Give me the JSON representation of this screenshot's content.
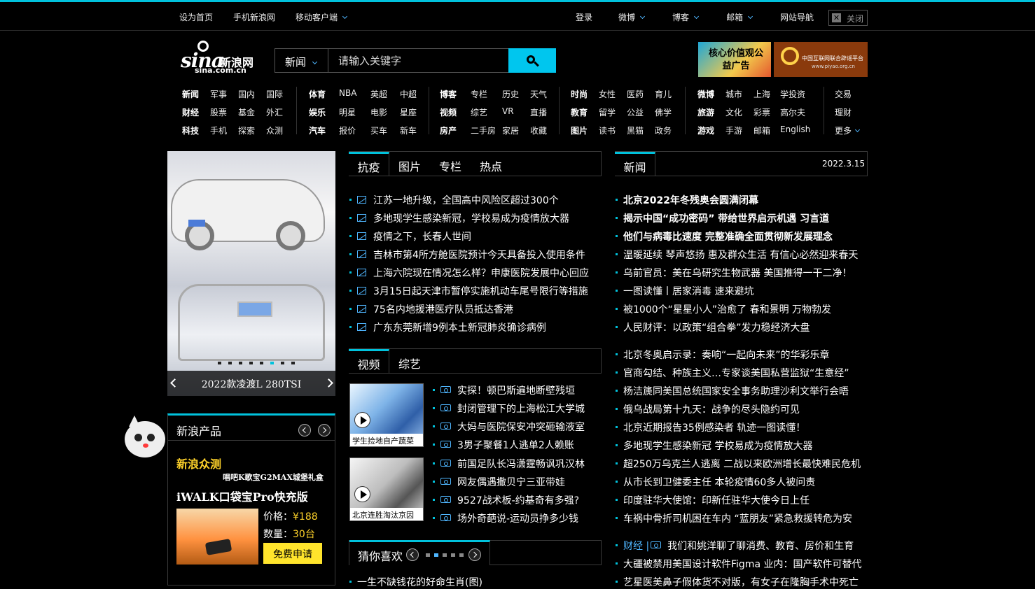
{
  "topbar": {
    "left": [
      "设为首页",
      "手机新浪网",
      "移动客户端"
    ],
    "right": [
      "登录",
      "微博",
      "博客",
      "邮箱",
      "网站导航"
    ],
    "close_label": "关闭"
  },
  "logo": {
    "text": "sina",
    "cn": "新浪网",
    "domain": "sina.com.cn"
  },
  "search": {
    "category": "新闻",
    "placeholder": "请输入关键字"
  },
  "ads": {
    "ad1": "核心价值观公益广告",
    "ad2_line1": "中国互联网联合辟谣平台",
    "ad2_line2": "www.piyao.org.cn"
  },
  "nav": {
    "col1": [
      [
        "新闻",
        "军事",
        "国内",
        "国际"
      ],
      [
        "财经",
        "股票",
        "基金",
        "外汇"
      ],
      [
        "科技",
        "手机",
        "探索",
        "众测"
      ]
    ],
    "col2": [
      [
        "体育",
        "NBA",
        "英超",
        "中超"
      ],
      [
        "娱乐",
        "明星",
        "电影",
        "星座"
      ],
      [
        "汽车",
        "报价",
        "买车",
        "新车"
      ]
    ],
    "col3": [
      [
        "博客",
        "专栏",
        "历史",
        "天气"
      ],
      [
        "视频",
        "综艺",
        "VR",
        "直播"
      ],
      [
        "房产",
        "二手房",
        "家居",
        "收藏"
      ]
    ],
    "col4": [
      [
        "时尚",
        "女性",
        "医药",
        "育儿"
      ],
      [
        "教育",
        "留学",
        "公益",
        "佛学"
      ],
      [
        "图片",
        "读书",
        "黑猫",
        "政务"
      ]
    ],
    "col5": [
      [
        "微博",
        "城市",
        "上海",
        "学投资"
      ],
      [
        "旅游",
        "文化",
        "彩票",
        "高尔夫"
      ],
      [
        "游戏",
        "手游",
        "邮箱",
        "English"
      ]
    ],
    "col6": [
      "交易",
      "理财",
      "更多"
    ]
  },
  "slide": {
    "caption": "2022款凌渡L 280TSI",
    "dot_count": 8,
    "active_dot": 5
  },
  "product": {
    "title": "新浪产品",
    "sub": "新浪众测",
    "tag": "唱吧K歌宝G2MAX城堡礼盒",
    "name": "iWALK口袋宝Pro快充版",
    "price_label": "价格：",
    "price": "¥188",
    "qty_label": "数量：",
    "qty": "30台",
    "apply": "免费申请"
  },
  "tabs1": {
    "items": [
      "抗疫",
      "图片",
      "专栏",
      "热点"
    ]
  },
  "list1": [
    "江苏一地升级，全国高中风险区超过300个",
    "多地现学生感染新冠，学校易成为疫情放大器",
    "疫情之下，长春人世间",
    "吉林市第4所方舱医院预计今天具备投入使用条件",
    "上海六院现在情况怎么样？申康医院发展中心回应",
    "3月15日起天津市暂停实施机动车尾号限行等措施",
    "75名内地援港医疗队员抵达香港",
    "广东东莞新增9例本土新冠肺炎确诊病例"
  ],
  "tabs2": {
    "items": [
      "视频",
      "综艺"
    ]
  },
  "videos": {
    "thumb1_caption": "学生捡地自产蔬菜",
    "thumb2_caption": "北京连胜淘汰京因",
    "items": [
      "实探！顿巴斯遍地断壁残垣",
      "封闭管理下的上海松江大学城",
      "大妈与医院保安冲突砸输液室",
      "3男子聚餐1人逃单2人赖账",
      "前国足队长冯潇霆畅讽巩汉林",
      "网友偶遇撒贝宁三亚带娃",
      "9527战术板-约基奇有多强?",
      "场外奇葩说-运动员挣多少钱"
    ]
  },
  "guess": {
    "title": "猜你喜欢",
    "dot_count": 5,
    "active_dot": 1
  },
  "bottom_item": "一生不缺钱花的好命生肖(图)",
  "news_tab": {
    "label": "新闻",
    "date": "2022.3.15"
  },
  "news_bold": [
    "北京2022年冬残奥会圆满闭幕",
    "揭示中国“成功密码” 带给世界启示机遇 习言道",
    "他们与病毒比速度 完整准确全面贯彻新发展理念"
  ],
  "news1": [
    "温暖延续 琴声悠扬 惠及群众生活 有信心必然迎来春天",
    "乌前官员：美在乌研究生物武器 美国推得一干二净！",
    "一图读懂丨居家消毒 速来避坑",
    "被1000个“星星小人”治愈了 春和景明 万物勃发",
    "人民财评：以政策“组合拳”发力稳经济大盘"
  ],
  "news2": [
    "北京冬奥启示录：奏响“一起向未来”的华彩乐章",
    "官商勾结、种族主义…专家谈美国私营监狱“生意经”",
    "杨洁篪同美国总统国家安全事务助理沙利文举行会晤",
    "俄乌战局第十九天：战争的尽头隐约可见",
    "北京近期报告35例感染者 轨迹一图读懂！",
    "多地现学生感染新冠 学校易成为疫情放大器",
    "超250万乌克兰人逃离 二战以来欧洲增长最快难民危机",
    "从市长到卫健委主任 本轮疫情60多人被问责",
    "印度驻华大使馆：印新任驻华大使今日上任",
    "车祸中骨折司机困在车内 “蓝朋友”紧急救援转危为安"
  ],
  "finance": {
    "prefix": "财经 |",
    "items": [
      "我们和姚洋聊了聊消费、教育、房价和生育"
    ]
  },
  "news3": [
    "大疆被禁用美国设计软件Figma 业内：国产软件可替代",
    "艺星医美鼻子假体货不对版，有女子在隆胸手术中死亡"
  ]
}
